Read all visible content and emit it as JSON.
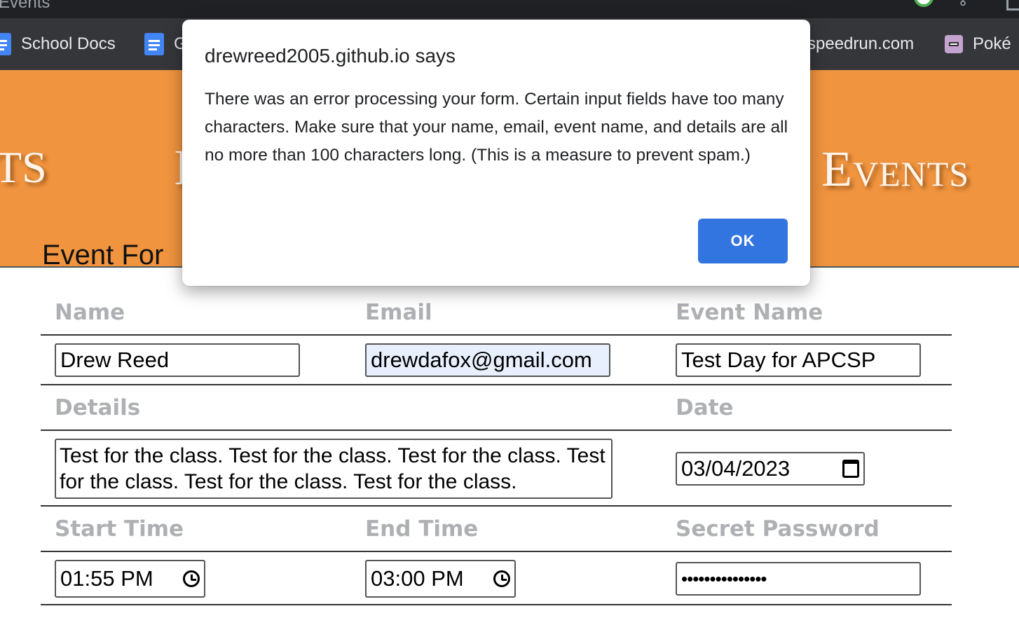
{
  "window": {
    "title": "Events"
  },
  "bookmarks": [
    {
      "label": "School Docs",
      "icon": "google-docs-icon"
    },
    {
      "label": "G",
      "icon": "google-docs-icon"
    },
    {
      "label": "speedrun.com",
      "icon": ""
    },
    {
      "label": "Poké",
      "icon": "pokemon-icon"
    }
  ],
  "header": {
    "left_text": "TS",
    "mid_text": "I",
    "right_text": "Events",
    "background": "#f0943f"
  },
  "page": {
    "partial_heading": "Event For"
  },
  "form": {
    "labels": {
      "name": "Name",
      "email": "Email",
      "event_name": "Event Name",
      "details": "Details",
      "date": "Date",
      "start_time": "Start Time",
      "end_time": "End Time",
      "secret_password": "Secret Password"
    },
    "values": {
      "name": "Drew Reed",
      "email": "drewdafox@gmail.com",
      "event_name": "Test Day for APCSP",
      "details": "Test for the class. Test for the class. Test for the class. Test for the class. Test for the class. Test for the class.",
      "date": "03/04/2023",
      "start_time": "01:55 PM",
      "end_time": "03:00 PM",
      "secret_password": "•••••••••••••••"
    }
  },
  "dialog": {
    "title": "drewreed2005.github.io says",
    "message": "There was an error processing your form. Certain input fields have too many characters. Make sure that your name, email, event name, and details are all no more than 100 characters long. (This is a measure to prevent spam.)",
    "ok_label": "OK",
    "button_color": "#3274e0"
  }
}
